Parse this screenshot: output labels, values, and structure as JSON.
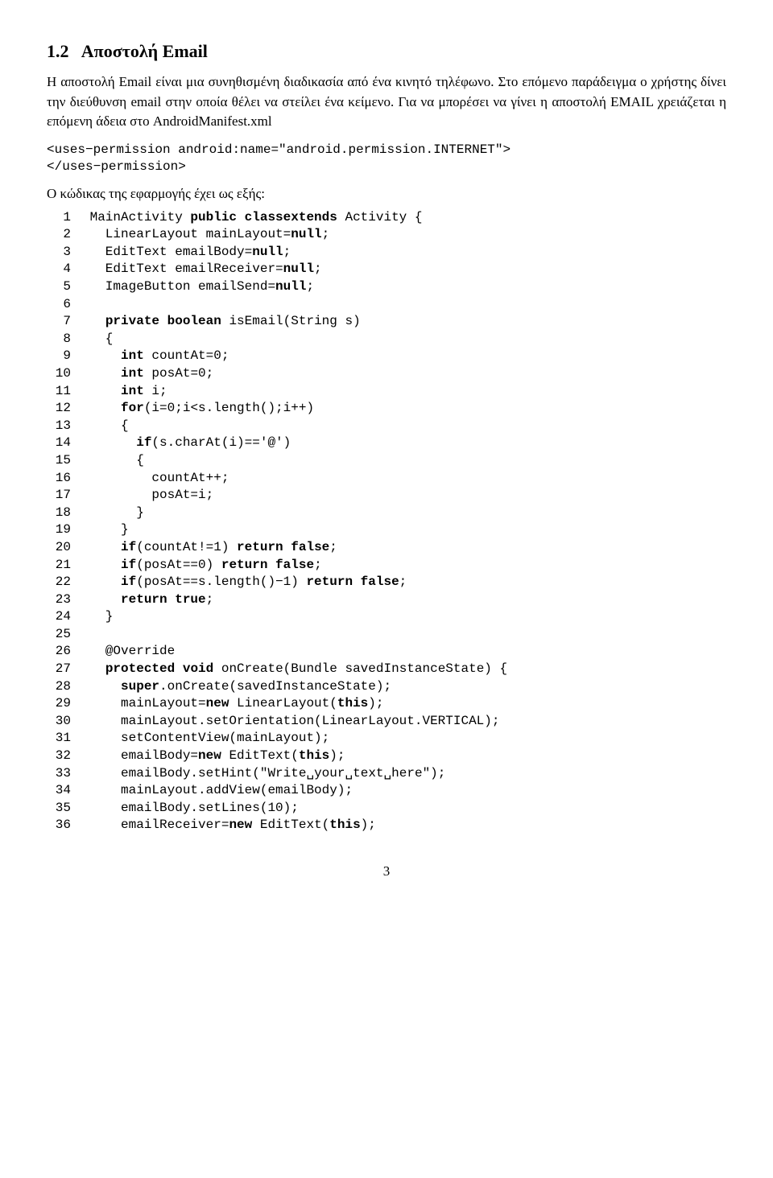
{
  "section": {
    "number": "1.2",
    "title": "Αποστολή Email"
  },
  "paragraphs": {
    "p1": "Η αποστολή Email είναι μια συνηθισμένη διαδικασία από ένα κινητό τηλέφωνο. Στο επόμενο παράδειγμα ο χρήστης δίνει την διεύθυνση email στην οποία θέλει να στείλει ένα κείμενο. Για να μπορέσει να γίνει η αποστολή EMAIL χρειάζεται η επόμενη άδεια στο AndroidManifest.xml",
    "p2": "Ο κώδικας της εφαρμογής έχει ως εξής:"
  },
  "code_manifest": [
    "<uses−permission android:name=\"android.permission.INTERNET\">",
    "</uses−permission>"
  ],
  "code_main": [
    {
      "n": "1",
      "bold": [
        "public",
        " class"
      ],
      "text": " MainActivity ",
      "bold2": [
        "extends"
      ],
      "tail": " Activity {"
    },
    {
      "n": "2",
      "text": "   LinearLayout mainLayout=",
      "bold": [
        "null"
      ],
      "tail": ";"
    },
    {
      "n": "3",
      "text": "   EditText emailBody=",
      "bold": [
        "null"
      ],
      "tail": ";"
    },
    {
      "n": "4",
      "text": "   EditText emailReceiver=",
      "bold": [
        "null"
      ],
      "tail": ";"
    },
    {
      "n": "5",
      "text": "   ImageButton emailSend=",
      "bold": [
        "null"
      ],
      "tail": ";"
    },
    {
      "n": "6",
      "text": ""
    },
    {
      "n": "7",
      "text": "   ",
      "bold": [
        "private",
        " boolean"
      ],
      "tail": " isEmail(String s)"
    },
    {
      "n": "8",
      "text": "   {"
    },
    {
      "n": "9",
      "text": "     ",
      "bold": [
        "int"
      ],
      "tail": " countAt=0;"
    },
    {
      "n": "10",
      "text": "     ",
      "bold": [
        "int"
      ],
      "tail": " posAt=0;"
    },
    {
      "n": "11",
      "text": "     ",
      "bold": [
        "int"
      ],
      "tail": " i;"
    },
    {
      "n": "12",
      "text": "     ",
      "bold": [
        "for"
      ],
      "tail": "(i=0;i<s.length();i++)"
    },
    {
      "n": "13",
      "text": "     {"
    },
    {
      "n": "14",
      "text": "       ",
      "bold": [
        "if"
      ],
      "tail": "(s.charAt(i)=='@')"
    },
    {
      "n": "15",
      "text": "       {"
    },
    {
      "n": "16",
      "text": "         countAt++;"
    },
    {
      "n": "17",
      "text": "         posAt=i;"
    },
    {
      "n": "18",
      "text": "       }"
    },
    {
      "n": "19",
      "text": "     }"
    },
    {
      "n": "20",
      "text": "     ",
      "bold": [
        "if"
      ],
      "mid": "(countAt!=1) ",
      "bold2": [
        "return",
        " false"
      ],
      "tail": ";"
    },
    {
      "n": "21",
      "text": "     ",
      "bold": [
        "if"
      ],
      "mid": "(posAt==0) ",
      "bold2": [
        "return",
        " false"
      ],
      "tail": ";"
    },
    {
      "n": "22",
      "text": "     ",
      "bold": [
        "if"
      ],
      "mid": "(posAt==s.length()−1) ",
      "bold2": [
        "return",
        " false"
      ],
      "tail": ";"
    },
    {
      "n": "23",
      "text": "     ",
      "bold": [
        "return",
        " true"
      ],
      "tail": ";"
    },
    {
      "n": "24",
      "text": "   }"
    },
    {
      "n": "25",
      "text": ""
    },
    {
      "n": "26",
      "text": "   @Override"
    },
    {
      "n": "27",
      "text": "   ",
      "bold": [
        "protected",
        " void"
      ],
      "tail": " onCreate(Bundle savedInstanceState) {"
    },
    {
      "n": "28",
      "text": "     ",
      "bold": [
        "super"
      ],
      "tail": ".onCreate(savedInstanceState);"
    },
    {
      "n": "29",
      "text": "     mainLayout=",
      "bold": [
        "new"
      ],
      "mid": " LinearLayout(",
      "bold2": [
        "this"
      ],
      "tail": ");"
    },
    {
      "n": "30",
      "text": "     mainLayout.setOrientation(LinearLayout.VERTICAL);"
    },
    {
      "n": "31",
      "text": "     setContentView(mainLayout);"
    },
    {
      "n": "32",
      "text": "     emailBody=",
      "bold": [
        "new"
      ],
      "mid": " EditText(",
      "bold2": [
        "this"
      ],
      "tail": ");"
    },
    {
      "n": "33",
      "text": "     emailBody.setHint(\"Write␣your␣text␣here\");"
    },
    {
      "n": "34",
      "text": "     mainLayout.addView(emailBody);"
    },
    {
      "n": "35",
      "text": "     emailBody.setLines(10);"
    },
    {
      "n": "36",
      "text": "     emailReceiver=",
      "bold": [
        "new"
      ],
      "mid": " EditText(",
      "bold2": [
        "this"
      ],
      "tail": ");"
    }
  ],
  "page_number": "3"
}
